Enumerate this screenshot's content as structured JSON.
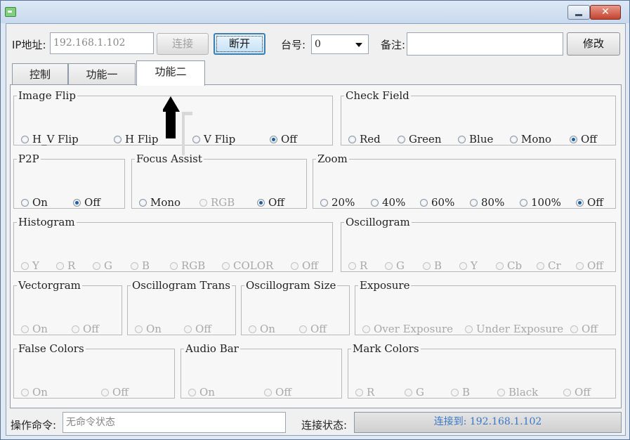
{
  "top": {
    "ip_label": "IP地址:",
    "ip_value": "192.168.1.102",
    "connect_label": "连接",
    "disconnect_label": "断开",
    "station_label": "台号:",
    "station_value": "0",
    "note_label": "备注:",
    "note_value": "",
    "modify_label": "修改"
  },
  "tabs": [
    "控制",
    "功能一",
    "功能二"
  ],
  "groups": {
    "image_flip": {
      "title": "Image Flip",
      "options": [
        "H_V Flip",
        "H Flip",
        "V Flip",
        "Off"
      ],
      "selected": "Off"
    },
    "check_field": {
      "title": "Check Field",
      "options": [
        "Red",
        "Green",
        "Blue",
        "Mono",
        "Off"
      ],
      "selected": "Off"
    },
    "p2p": {
      "title": "P2P",
      "options": [
        "On",
        "Off"
      ],
      "selected": "Off"
    },
    "focus_assist": {
      "title": "Focus Assist",
      "options": [
        "Mono",
        "RGB",
        "Off"
      ],
      "selected": "Off",
      "disabled": [
        "RGB"
      ]
    },
    "zoom": {
      "title": "Zoom",
      "options": [
        "20%",
        "40%",
        "60%",
        "80%",
        "100%",
        "Off"
      ],
      "selected": "Off"
    },
    "histogram": {
      "title": "Histogram",
      "options": [
        "Y",
        "R",
        "G",
        "B",
        "RGB",
        "COLOR",
        "Off"
      ],
      "disabled_all": true
    },
    "oscillogram": {
      "title": "Oscillogram",
      "options": [
        "R",
        "G",
        "B",
        "Y",
        "Cb",
        "Cr",
        "Off"
      ],
      "disabled_all": true
    },
    "vectorgram": {
      "title": "Vectorgram",
      "options": [
        "On",
        "Off"
      ],
      "disabled_all": true
    },
    "oscillogram_trans": {
      "title": "Oscillogram Trans",
      "options": [
        "On",
        "Off"
      ],
      "disabled_all": true
    },
    "oscillogram_size": {
      "title": "Oscillogram Size",
      "options": [
        "On",
        "Off"
      ],
      "disabled_all": true
    },
    "exposure": {
      "title": "Exposure",
      "options": [
        "Over Exposure",
        "Under Exposure",
        "Off"
      ],
      "disabled_all": true
    },
    "false_colors": {
      "title": "False Colors",
      "options": [
        "On",
        "Off"
      ],
      "disabled_all": true
    },
    "audio_bar": {
      "title": "Audio Bar",
      "options": [
        "On",
        "Off"
      ],
      "disabled_all": true
    },
    "mark_colors": {
      "title": "Mark Colors",
      "options": [
        "R",
        "G",
        "B",
        "Black",
        "Off"
      ],
      "disabled_all": true
    }
  },
  "bottom": {
    "command_label": "操作命令:",
    "command_value": "无命令状态",
    "status_label": "连接状态:",
    "status_value": "连接到: 192.168.1.102"
  },
  "colors": {
    "accent": "#1f5fa0",
    "status_text": "#3b78c5",
    "arrow": "#000000"
  },
  "icons": [
    "app-icon",
    "minimize-icon",
    "close-icon",
    "chevron-down-icon",
    "arrow-up-icon"
  ]
}
